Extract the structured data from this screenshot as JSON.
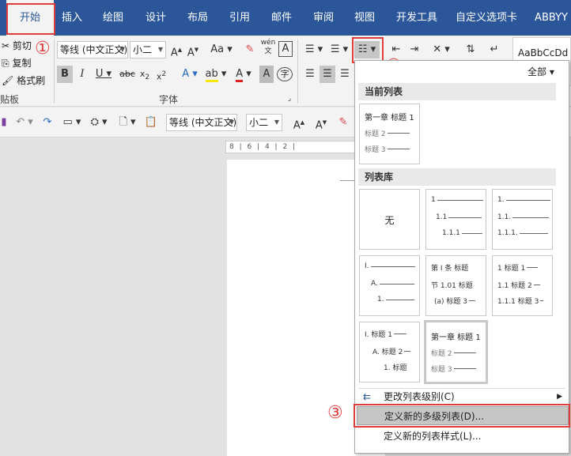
{
  "tabs": [
    "开始",
    "插入",
    "绘图",
    "设计",
    "布局",
    "引用",
    "邮件",
    "审阅",
    "视图",
    "开发工具",
    "自定义选项卡",
    "ABBYY"
  ],
  "clipboard": {
    "cut": "剪切",
    "copy": "复制",
    "format_painter": "格式刷",
    "group_label": "贴板"
  },
  "font": {
    "name": "等线 (中文正文)",
    "size": "小二",
    "group_label": "字体",
    "case": "Aa"
  },
  "styles": {
    "preview": "AaBbCcDd"
  },
  "qat": {
    "font_name": "等线 (中文正文)",
    "font_size": "小二"
  },
  "ruler": "8 | 6 | 4 | 2 |",
  "annotations": [
    "①",
    "②",
    "③"
  ],
  "panel": {
    "filter": "全部",
    "current_header": "当前列表",
    "library_header": "列表库",
    "current_list": [
      "第一章 标题 1",
      "标题 2",
      "标题 3"
    ],
    "none_label": "无",
    "tiles": [
      {
        "lines": [
          "1",
          "1.1",
          "1.1.1"
        ]
      },
      {
        "lines": [
          "1.",
          "1.1.",
          "1.1.1."
        ]
      },
      {
        "lines": [
          "I.",
          "A.",
          "1."
        ]
      },
      {
        "lines": [
          "第 I 条 标题",
          "节 1.01 标题",
          "(a) 标题 3"
        ]
      },
      {
        "lines": [
          "1 标题 1",
          "1.1 标题 2",
          "1.1.1 标题 3"
        ]
      },
      {
        "lines": [
          "I. 标题 1",
          "A. 标题 2",
          "1. 标题"
        ]
      },
      {
        "lines": [
          "第一章 标题 1",
          "标题 2",
          "标题 3"
        ]
      }
    ],
    "menu": {
      "change_level": "更改列表级别(C)",
      "define_new_multilevel": "定义新的多级列表(D)...",
      "define_new_style": "定义新的列表样式(L)..."
    }
  },
  "colors": {
    "titlebar": "#2b579a",
    "annotation": "#e03c3c"
  }
}
